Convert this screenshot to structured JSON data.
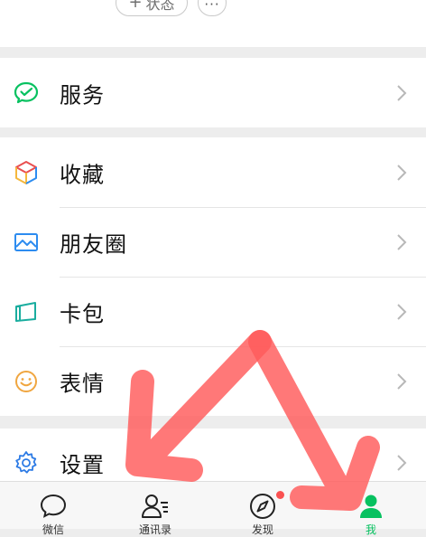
{
  "profile": {
    "status_button": {
      "icon": "plus-icon",
      "label": "状态"
    },
    "more_button": {
      "icon": "more-dots-icon",
      "label": "···"
    }
  },
  "menu": {
    "services": {
      "label": "服务",
      "icon": "wechat-pay-icon",
      "color": "#07c160"
    },
    "favorites": {
      "label": "收藏",
      "icon": "cube-icon"
    },
    "moments": {
      "label": "朋友圈",
      "icon": "picture-icon",
      "color": "#2d8cf0"
    },
    "cards": {
      "label": "卡包",
      "icon": "card-wallet-icon",
      "color": "#1aad9f"
    },
    "stickers": {
      "label": "表情",
      "icon": "smiley-icon",
      "color": "#f0a640"
    },
    "settings": {
      "label": "设置",
      "icon": "gear-icon",
      "color": "#2d7be5"
    }
  },
  "tabbar": {
    "tabs": [
      {
        "label": "微信",
        "icon": "chat-bubble-icon"
      },
      {
        "label": "通讯录",
        "icon": "contacts-icon"
      },
      {
        "label": "发现",
        "icon": "compass-icon",
        "has_badge": true
      },
      {
        "label": "我",
        "icon": "person-icon",
        "active": true
      }
    ],
    "active_color": "#07c160"
  },
  "annotation": {
    "description_color": "#ff5a5a"
  }
}
